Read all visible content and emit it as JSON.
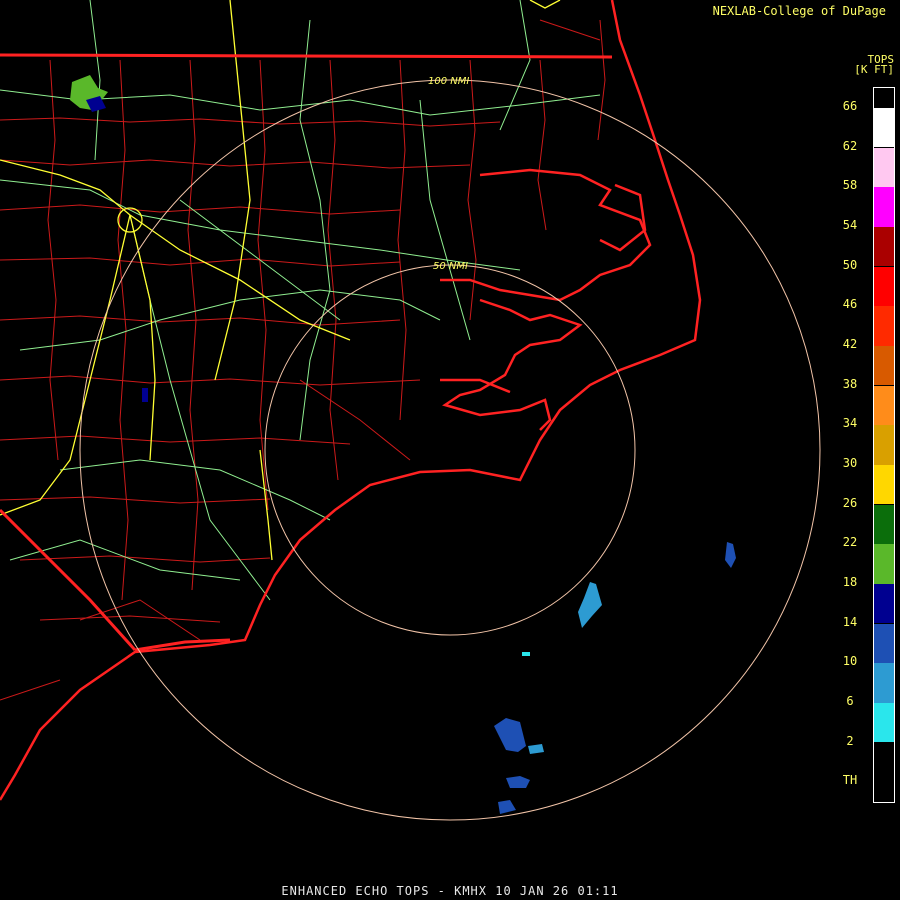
{
  "header": {
    "credit": "NEXLAB-College of DuPage"
  },
  "footer": {
    "title": "ENHANCED ECHO TOPS - KMHX 10 JAN 26 01:11"
  },
  "map": {
    "ring_labels": [
      "50 NMI",
      "100 NMI"
    ],
    "colors": {
      "state_border": "#ff2222",
      "county_lines": "#cc1a1a",
      "interstates": "#ffff33",
      "highways": "#90ee90",
      "range_rings": "#f2c4a8"
    }
  },
  "legend": {
    "title_line1": "TOPS",
    "title_line2": "[K FT]",
    "labels": [
      "66",
      "62",
      "58",
      "54",
      "50",
      "46",
      "42",
      "38",
      "34",
      "30",
      "26",
      "22",
      "18",
      "14",
      "10",
      "6",
      "2",
      "TH"
    ],
    "colors": [
      "#ffffff",
      "#ffc8f0",
      "#ff00ff",
      "#aa0000",
      "#ff0000",
      "#ff2a00",
      "#d85a00",
      "#ff8c1a",
      "#d9a000",
      "#ffd700",
      "#0b6e0b",
      "#5ab82a",
      "#000090",
      "#1e50b4",
      "#2d9bd2",
      "#2ae6ec",
      "#000000"
    ]
  }
}
